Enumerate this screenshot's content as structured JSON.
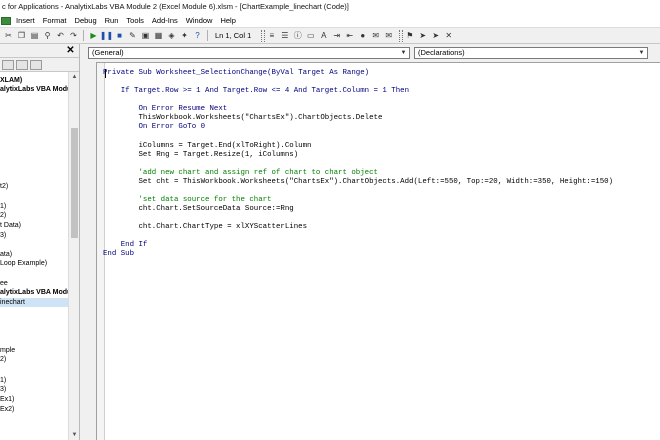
{
  "window": {
    "title": "c for Applications - AnalytixLabs VBA Module 2 (Excel Module 6).xlsm - [ChartExample_linechart (Code)]"
  },
  "menu": [
    "Insert",
    "Format",
    "Debug",
    "Run",
    "Tools",
    "Add-Ins",
    "Window",
    "Help"
  ],
  "toolbar": {
    "position": "Ln 1, Col 1"
  },
  "editor": {
    "object_combo": "(General)",
    "procedure_combo": "(Declarations)"
  },
  "project_tree": [
    "XLAM)",
    "alytixLabs VBA Modu",
    "t2)",
    "1)",
    "2)",
    "t Data)",
    "3)",
    "ata)",
    "Loop Example)",
    "ee",
    "alytixLabs VBA Modu",
    "inechart",
    "mple",
    "2)",
    "1)",
    "3)",
    "Ex1)",
    "Ex2)"
  ],
  "code": [
    "Private Sub Worksheet_SelectionChange(ByVal Target As Range)",
    "",
    "    If Target.Row >= 1 And Target.Row <= 4 And Target.Column = 1 Then",
    "",
    "        On Error Resume Next",
    "        ThisWorkbook.Worksheets(\"ChartsEx\").ChartObjects.Delete",
    "        On Error GoTo 0",
    "",
    "        iColumns = Target.End(xlToRight).Column",
    "        Set Rng = Target.Resize(1, iColumns)",
    "",
    "        'add new chart and assign ref of chart to chart object",
    "        Set cht = ThisWorkbook.Worksheets(\"ChartsEx\").ChartObjects.Add(Left:=550, Top:=20, Width:=350, Height:=150)",
    "",
    "        'set data source for the chart",
    "        cht.Chart.SetSourceData Source:=Rng",
    "",
    "        cht.Chart.ChartType = xlXYScatterLines",
    "",
    "    End If",
    "End Sub"
  ]
}
